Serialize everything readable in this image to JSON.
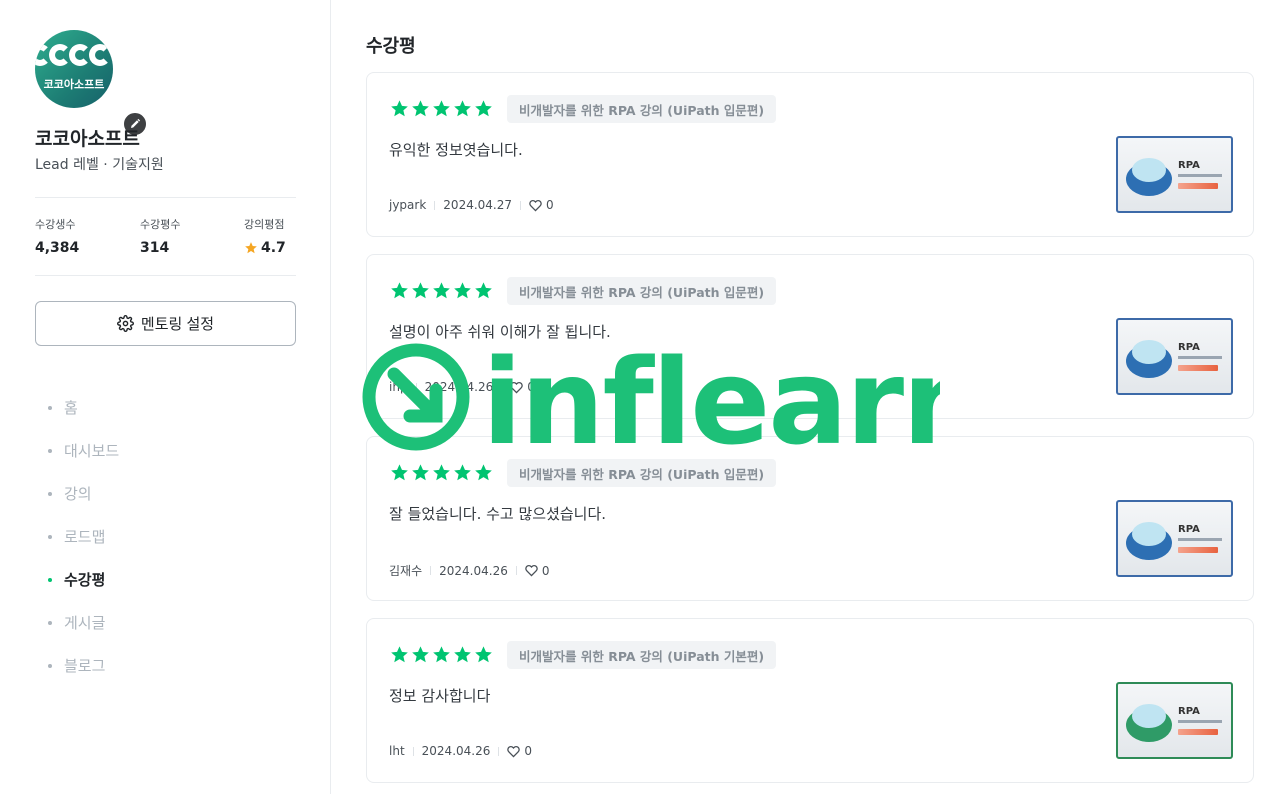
{
  "profile": {
    "avatar_text": "코코아소프트",
    "name": "코코아소프트",
    "subtitle": "Lead 레벨 · 기술지원"
  },
  "stats": [
    {
      "label": "수강생수",
      "value": "4,384"
    },
    {
      "label": "수강평수",
      "value": "314"
    },
    {
      "label": "강의평점",
      "value": "4.7"
    }
  ],
  "mentor_button": {
    "label": "멘토링 설정"
  },
  "nav": [
    {
      "label": "홈",
      "active": false
    },
    {
      "label": "대시보드",
      "active": false
    },
    {
      "label": "강의",
      "active": false
    },
    {
      "label": "로드맵",
      "active": false
    },
    {
      "label": "수강평",
      "active": true
    },
    {
      "label": "게시글",
      "active": false
    },
    {
      "label": "블로그",
      "active": false
    }
  ],
  "section_title": "수강평",
  "reviews": [
    {
      "rating": 5,
      "course": "비개발자를 위한 RPA 강의 (UiPath 입문편)",
      "text": "유익한 정보엿습니다.",
      "author": "jypark",
      "date": "2024.04.27",
      "likes": "0",
      "thumb_title": "RPA"
    },
    {
      "rating": 5,
      "course": "비개발자를 위한 RPA 강의 (UiPath 입문편)",
      "text": "설명이 아주 쉬워 이해가 잘 됩니다.",
      "author": "ihp",
      "date": "2024.04.26",
      "likes": "0",
      "thumb_title": "RPA"
    },
    {
      "rating": 5,
      "course": "비개발자를 위한 RPA 강의 (UiPath 입문편)",
      "text": "잘 들었습니다. 수고 많으셨습니다.",
      "author": "김재수",
      "date": "2024.04.26",
      "likes": "0",
      "thumb_title": "RPA"
    },
    {
      "rating": 5,
      "course": "비개발자를 위한 RPA 강의 (UiPath 기본편)",
      "text": "정보 감사합니다",
      "author": "lht",
      "date": "2024.04.26",
      "likes": "0",
      "thumb_title": "RPA"
    }
  ],
  "watermark": {
    "text": "inflearn",
    "color": "#1dc078"
  },
  "colors": {
    "accent": "#00c471",
    "star": "#00c471",
    "rating_star": "#f5a623"
  }
}
